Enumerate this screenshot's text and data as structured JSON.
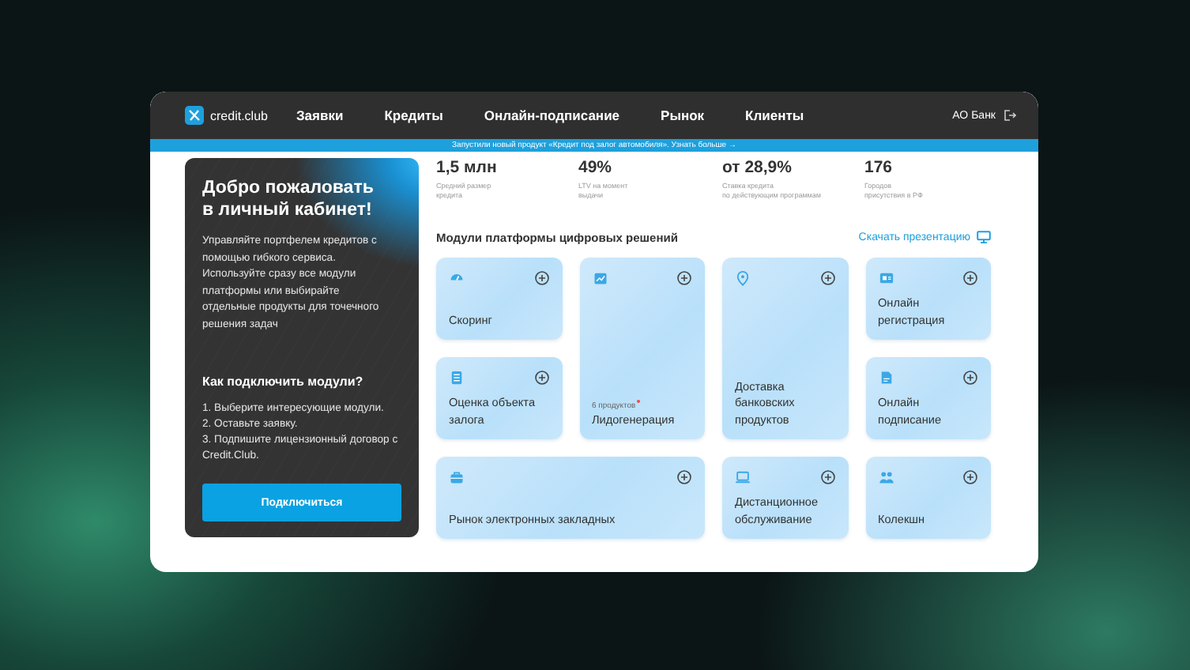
{
  "brand": {
    "name": "credit.club"
  },
  "nav": [
    {
      "label": "Заявки",
      "selected": false
    },
    {
      "label": "Кредиты",
      "selected": false
    },
    {
      "label": "Онлайн-подписание",
      "selected": false
    },
    {
      "label": "Рынок",
      "selected": false
    },
    {
      "label": "Клиенты",
      "selected": false
    }
  ],
  "account": {
    "name": "АО Банк"
  },
  "announcement": "Запустили новый продукт «Кредит под залог автомобиля». Узнать больше →",
  "welcome": {
    "title": "Добро пожаловать в личный кабинет!",
    "text": "Управляйте портфелем кредитов с помощью гибкого сервиса. Используйте сразу все модули платформы или выбирайте отдельные продукты для точечного решения задач",
    "how_title": "Как подключить модули?",
    "steps": [
      "1. Выберите интересующие модули.",
      "2. Оставьте заявку.",
      "3. Подпишите лицензионный договор с Credit.Club."
    ],
    "button": "Подключиться"
  },
  "stats": [
    {
      "value": "1,5 млн",
      "caption": "Средний размер\nкредита"
    },
    {
      "value": "49%",
      "caption": "LTV на момент\nвыдачи"
    },
    {
      "value": "от 28,9%",
      "caption": "Ставка кредита\nпо действующим программам"
    },
    {
      "value": "176",
      "caption": "Городов\nприсутствия в РФ"
    }
  ],
  "modules": {
    "title": "Модули платформы цифровых решений",
    "download_link": "Скачать презентацию",
    "items": [
      {
        "kind": "small",
        "name": "Скоринг"
      },
      {
        "kind": "tall",
        "name": "Лидогенерация",
        "note": "6 продуктов"
      },
      {
        "kind": "tall",
        "name": "Доставка банковских продуктов"
      },
      {
        "kind": "small",
        "name": "Онлайн регистрация"
      },
      {
        "kind": "small",
        "name": "Оценка объекта залога"
      },
      {
        "kind": "small",
        "name": "Онлайн подписание"
      },
      {
        "kind": "wide",
        "name": "Рынок электронных закладных"
      },
      {
        "kind": "small",
        "name": "Дистанционное обслуживание"
      },
      {
        "kind": "small",
        "name": "Колекшн"
      }
    ]
  }
}
